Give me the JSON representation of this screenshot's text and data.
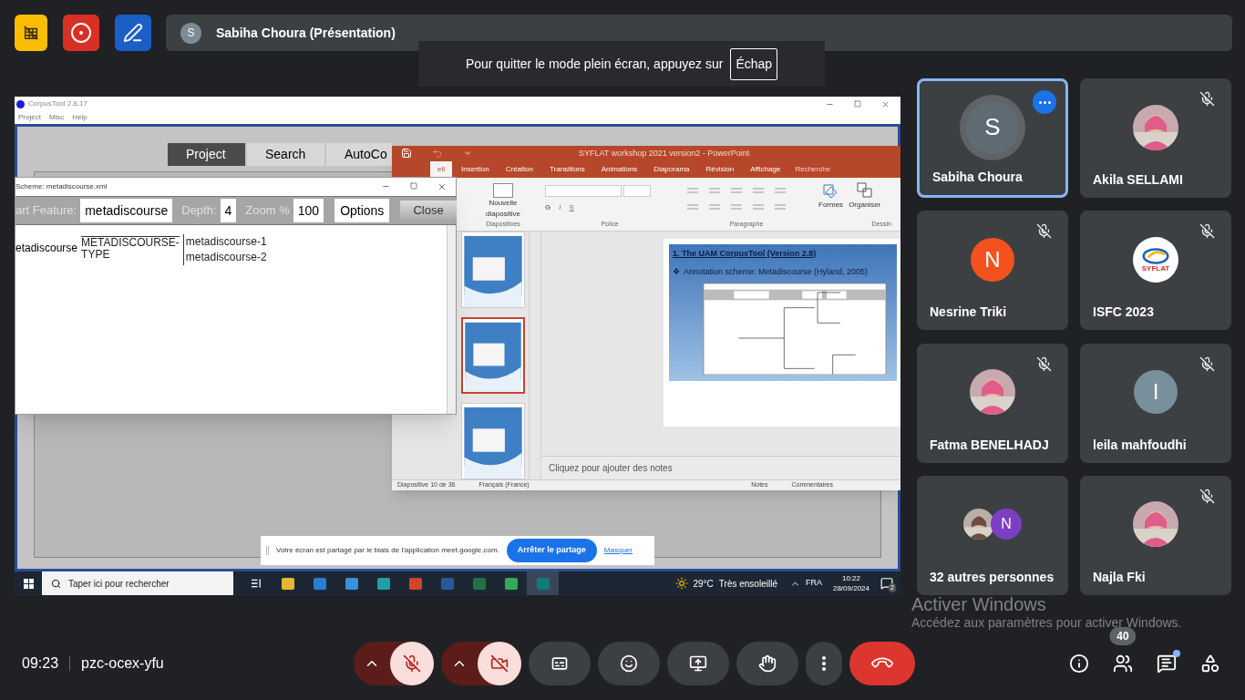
{
  "top_bar": {
    "presenter": {
      "initial": "S",
      "label": "Sabiha Choura (Présentation)"
    }
  },
  "fullscreen_notice": {
    "text": "Pour quitter le mode plein écran, appuyez sur",
    "key": "Échap"
  },
  "shared_screen": {
    "corpustool": {
      "title": "CorpusTool 2.8.17",
      "menu": [
        "Project",
        "Misc",
        "Help"
      ],
      "tabs": [
        {
          "label": "Project",
          "selected": true
        },
        {
          "label": "Search",
          "selected": false
        },
        {
          "label": "AutoCo",
          "selected": false
        }
      ]
    },
    "scheme_window": {
      "title": "Scheme: metadiscourse.xml",
      "feature_label": "art Feature:",
      "feature": "metadiscourse",
      "depth_label": "Depth:",
      "depth": "4",
      "zoom_label": "Zoom %",
      "zoom": "100",
      "options_button": "Options",
      "close_button": "Close",
      "tree": {
        "root": "etadiscourse",
        "system": "METADISCOURSE-",
        "system_line2": "TYPE",
        "options": [
          "metadiscourse-1",
          "metadiscourse-2"
        ]
      }
    },
    "powerpoint": {
      "title": "SYFLAT workshop 2021 version2 - PowerPoint",
      "tabs": [
        {
          "label": "eil",
          "selected": true
        },
        {
          "label": "Insertion",
          "selected": false
        },
        {
          "label": "Création",
          "selected": false
        },
        {
          "label": "Transitions",
          "selected": false
        },
        {
          "label": "Animations",
          "selected": false
        },
        {
          "label": "Diaporama",
          "selected": false
        },
        {
          "label": "Révision",
          "selected": false
        },
        {
          "label": "Affichage",
          "selected": false
        }
      ],
      "tell_me": "Recherche",
      "new_slide": "Nouvelle diapositive",
      "groups": [
        "Diapositives",
        "Police",
        "Paragraphe",
        "Dessin"
      ],
      "font_styles": [
        "G",
        "I",
        "S"
      ],
      "drawing_tools": [
        "Formes",
        "Organiser"
      ],
      "thumbnails": [
        {
          "selected": false
        },
        {
          "selected": true
        },
        {
          "selected": false
        }
      ],
      "slide": {
        "title": "1. The UAM CorpusTool (Version 2.8)",
        "bullet_mark": "❖",
        "bullet": "Annotation scheme: Metadiscourse (Hyland, 2005)"
      },
      "notes_placeholder": "Cliquez pour ajouter des notes",
      "status": {
        "slide": "Diapositive 10 de 36",
        "language": "Français (France)",
        "notes": "Notes",
        "comments": "Commentaires"
      }
    },
    "share_bar": {
      "text": "Votre écran est partagé par le biais de l'application meet.google.com.",
      "stop": "Arrêter le partage",
      "hide": "Masquer"
    },
    "taskbar": {
      "search_placeholder": "Taper ici pour rechercher",
      "apps": [
        {
          "color": "#e8b730",
          "selected": false
        },
        {
          "color": "#2b7cd3",
          "selected": false
        },
        {
          "color": "#3d8fd8",
          "selected": false
        },
        {
          "color": "#1fa0a8",
          "selected": false
        },
        {
          "color": "#d2452a",
          "selected": false
        },
        {
          "color": "#2b579a",
          "selected": false
        },
        {
          "color": "#217346",
          "selected": false
        },
        {
          "color": "#34a853",
          "selected": false
        },
        {
          "color": "#0f7a7a",
          "selected": true
        }
      ],
      "temperature": "29°C",
      "weather": "Très ensoleillé",
      "language": "FRA",
      "time": "10:22",
      "date": "28/09/2024",
      "notifications": "2"
    }
  },
  "participants": [
    {
      "kind": "initial",
      "name": "Sabiha Choura",
      "initial": "S",
      "color": "#5f6b73",
      "muted": false,
      "highlighted": true
    },
    {
      "name": "Akila SELLAMI",
      "muted": true,
      "highlighted": false
    },
    {
      "kind": "initial",
      "name": "Nesrine Triki",
      "initial": "N",
      "color": "#f4511e",
      "muted": true,
      "highlighted": false
    },
    {
      "kind": "logo",
      "name": "ISFC 2023",
      "logo_text": "SYFLAT",
      "muted": true,
      "highlighted": false
    },
    {
      "name": "Fatma BENELHADJ",
      "muted": true,
      "highlighted": false
    },
    {
      "kind": "initial",
      "name": "leila mahfoudhi",
      "initial": "I",
      "color": "#78909c",
      "muted": true,
      "highlighted": false
    },
    {
      "kind": "others",
      "name": "32 autres personnes",
      "extra_initial": "N",
      "color": "#7b3fc4",
      "muted": false,
      "highlighted": false
    },
    {
      "name": "Najla Fki",
      "muted": true,
      "highlighted": false
    }
  ],
  "activation": {
    "title": "Activer Windows",
    "text": "Accédez aux paramètres pour activer Windows."
  },
  "bottom_bar": {
    "time": "09:23",
    "meeting_code": "pzc-ocex-yfu",
    "mic_on": false,
    "camera_on": false,
    "people_count": "40",
    "chat_unread": true
  }
}
